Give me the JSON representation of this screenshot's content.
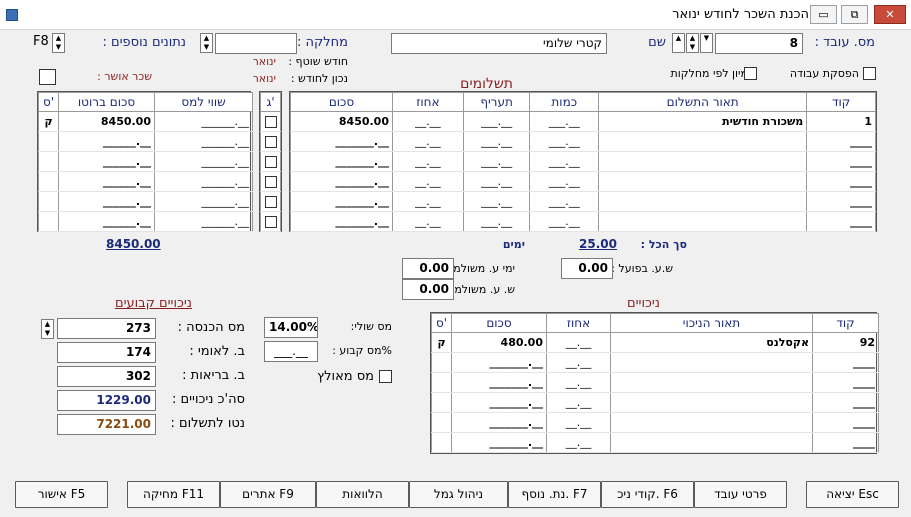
{
  "window": {
    "title": "הכנת השכר לחודש ינואר",
    "minimize_icon": "minimize-icon",
    "restore_icon": "restore-icon",
    "close_icon": "close-icon"
  },
  "header": {
    "employee_no_label": "מס. עובד :",
    "employee_no_value": "8",
    "name_label": "שם",
    "name_value": "קטרי שלומי",
    "department_label": "מחלקה :",
    "department_value": "",
    "more_data_label": "נתונים נוספים :",
    "more_data_key": "F8",
    "current_month_label": "חודש שוטף :",
    "current_month_value": "ינואר",
    "for_month_label": "נכון לחודש :",
    "for_month_value": "ינואר",
    "approved_wage_label": "שכר אושר :",
    "sort_by_dept_label": "מיון לפי מחלקות",
    "stop_work_label": "הפסקת עבודה"
  },
  "payments": {
    "title": "תשלומים",
    "columns": [
      "קוד",
      "תאור התשלום",
      "כמות",
      "תעריף",
      "אחוז",
      "סכום",
      "ג'"
    ],
    "rows": [
      {
        "code": "1",
        "desc": "משכורת חודשית",
        "qty": "___.__",
        "rate": "___.__",
        "pct": "__.__",
        "amount": "8450.00"
      },
      {
        "code": "____",
        "desc": "",
        "qty": "___.__",
        "rate": "___.__",
        "pct": "__.__",
        "amount": "_______.__"
      },
      {
        "code": "____",
        "desc": "",
        "qty": "___.__",
        "rate": "___.__",
        "pct": "__.__",
        "amount": "_______.__"
      },
      {
        "code": "____",
        "desc": "",
        "qty": "___.__",
        "rate": "___.__",
        "pct": "__.__",
        "amount": "_______.__"
      },
      {
        "code": "____",
        "desc": "",
        "qty": "___.__",
        "rate": "___.__",
        "pct": "__.__",
        "amount": "_______.__"
      },
      {
        "code": "____",
        "desc": "",
        "qty": "___.__",
        "rate": "___.__",
        "pct": "__.__",
        "amount": "_______.__"
      }
    ],
    "total_label": "סך הכל :",
    "total_value": "25.00",
    "days_label": "ימים"
  },
  "tax_grid": {
    "columns": [
      "שווי למס",
      "סכום ברוטו",
      "ס'"
    ],
    "rows": [
      {
        "tax": "______.__",
        "gross": "8450.00",
        "s": "ק"
      },
      {
        "tax": "______.__",
        "gross": "______.__",
        "s": ""
      },
      {
        "tax": "______.__",
        "gross": "______.__",
        "s": ""
      },
      {
        "tax": "______.__",
        "gross": "______.__",
        "s": ""
      },
      {
        "tax": "______.__",
        "gross": "______.__",
        "s": ""
      },
      {
        "tax": "______.__",
        "gross": "______.__",
        "s": ""
      }
    ],
    "gross_total": "8450.00"
  },
  "work_hours": {
    "actual_label": "ש.ע. בפועל :",
    "actual_value": "0.00",
    "paid_days_label": "ימי ע. משולמים :",
    "paid_days_value": "0.00",
    "paid_hours_label": "ש. ע. משולמים :",
    "paid_hours_value": "0.00"
  },
  "fixed_deductions": {
    "title": "ניכויים קבועים",
    "income_tax_label": "מס הכנסה :",
    "income_tax_value": "273",
    "national_ins_label": "ב. לאומי :",
    "national_ins_value": "174",
    "health_label": "ב. בריאות :",
    "health_value": "302",
    "total_label": "סה'כ ניכויים :",
    "total_value": "1229.00",
    "net_label": "נטו לתשלום :",
    "net_value": "7221.00",
    "marginal_tax_label": "מס שולי:",
    "marginal_tax_value": "14.00%",
    "fixed_tax_label": "%מס קבוע :",
    "fixed_tax_value": "___.__",
    "grossed_tax_label": "מס מאולץ"
  },
  "deductions": {
    "title": "ניכויים",
    "columns": [
      "קוד",
      "תאור הניכוי",
      "אחוז",
      "סכום",
      "ס'"
    ],
    "rows": [
      {
        "code": "92",
        "desc": "אקסלנס",
        "pct": "__.__",
        "amount": "480.00",
        "s": "ק"
      },
      {
        "code": "____",
        "desc": "",
        "pct": "__.__",
        "amount": "_______.__",
        "s": ""
      },
      {
        "code": "____",
        "desc": "",
        "pct": "__.__",
        "amount": "_______.__",
        "s": ""
      },
      {
        "code": "____",
        "desc": "",
        "pct": "__.__",
        "amount": "_______.__",
        "s": ""
      },
      {
        "code": "____",
        "desc": "",
        "pct": "__.__",
        "amount": "_______.__",
        "s": ""
      },
      {
        "code": "____",
        "desc": "",
        "pct": "__.__",
        "amount": "_______.__",
        "s": ""
      }
    ]
  },
  "buttons": {
    "exit": "יציאה Esc",
    "employee": "פרטי עובד",
    "codes": "קודי ניכ. F6",
    "extra": "נת. נוסף. F7",
    "provident": "ניהול גמל",
    "loans": "הלוואות",
    "warnings": "אתרים F9",
    "delete": "מחיקה F11",
    "approve": "אישור F5"
  },
  "colors": {
    "navy": "#1c2a7a",
    "maroon": "#8a1f1f",
    "close": "#c74a3a"
  }
}
